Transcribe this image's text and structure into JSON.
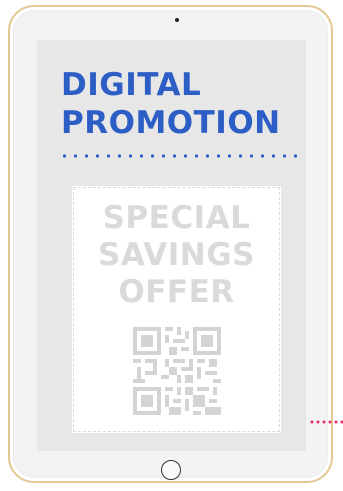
{
  "headline": {
    "line1": "DIGITAL",
    "line2": "PROMOTION"
  },
  "coupon": {
    "line1": "SPECIAL",
    "line2": "SAVINGS",
    "line3": "OFFER"
  },
  "colors": {
    "headline": "#2d5ec5",
    "coupon_text": "#dadada",
    "qr": "#d4d4d4",
    "accent_dots": "#e8336a",
    "bezel_trim": "#e3c893",
    "screen": "#e7e7e7"
  },
  "icons": {
    "qr": "qr-code-icon",
    "home": "home-button-icon",
    "camera": "camera-icon"
  }
}
